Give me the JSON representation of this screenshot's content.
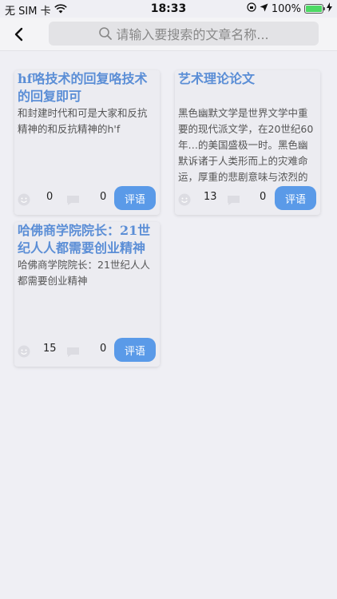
{
  "status_bar": {
    "carrier": "无 SIM 卡",
    "time": "18:33",
    "battery": "100%",
    "battery_level": 1.0
  },
  "header": {
    "search_placeholder": "请输入要搜索的文章名称..."
  },
  "colors": {
    "accent": "#5a9ae8",
    "title": "#5b8ed6",
    "background": "#efeff4"
  },
  "articles": [
    {
      "title": "hf咯技术的回复咯技术的回复即可",
      "summary": "和封建时代和可是大家和反抗精神的和反抗精神的h'f",
      "likes": "0",
      "comments": "0",
      "button": "评语"
    },
    {
      "title": "艺术理论论文",
      "summary": "黑色幽默文学是世界文学中重要的现代派文学，在20世纪60年…的美国盛极一时。黑色幽默诉诸于人类形而上的灾难命运，厚重的悲剧意味与浓烈的喜剧色彩之",
      "likes": "13",
      "comments": "0",
      "button": "评语"
    },
    {
      "title": "哈佛商学院院长：21世纪人人都需要创业精神",
      "summary": "哈佛商学院院长：21世纪人人都需要创业精神",
      "likes": "15",
      "comments": "0",
      "button": "评语"
    }
  ]
}
